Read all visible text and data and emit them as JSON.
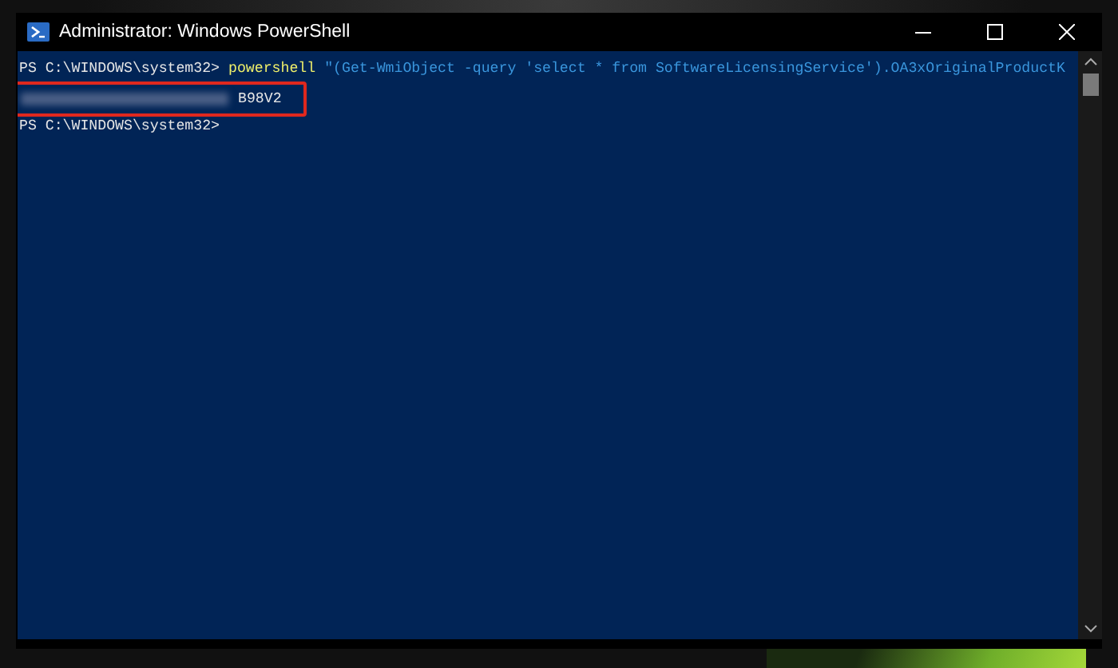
{
  "window": {
    "title": "Administrator: Windows PowerShell"
  },
  "console": {
    "lines": [
      {
        "kind": "command",
        "prompt": "PS C:\\WINDOWS\\system32>",
        "command": "powershell",
        "argument": "\"(Get-WmiObject -query 'select * from SoftwareLicensingService').OA3xOriginalProductK"
      },
      {
        "kind": "redacted",
        "value": "B98V2",
        "highlighted": true
      },
      {
        "kind": "prompt",
        "prompt": "PS C:\\WINDOWS\\system32>"
      }
    ]
  }
}
